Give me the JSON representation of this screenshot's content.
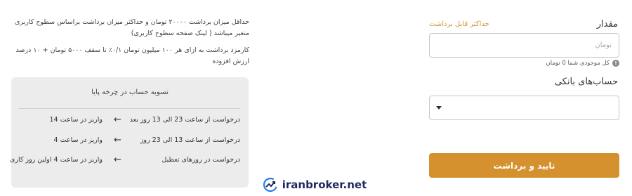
{
  "form": {
    "amount_label": "مقدار",
    "max_link": "حداکثر قابل برداشت",
    "amount_placeholder": "تومان",
    "balance_text": "کل موجودی شما 0 تومان",
    "info_icon": "info-icon",
    "bank_label": "حساب‌های بانکی",
    "bank_select_value": "",
    "submit_label": "تایید و برداشت"
  },
  "info": {
    "line1": "حداقل میزان برداشت ۲۰۰۰۰ تومان و حداکثر میزان برداشت براساس سطوح کاربری متغیر میباشد ( لینک صفحه سطوح کاربری)",
    "line2": "کارمزد برداشت به ازای هر ۱۰۰ میلیون تومان ۰/۱٪ تا سقف ۵۰۰۰ تومان + ۱۰ درصد ارزش افزوده"
  },
  "schedule": {
    "title": "تسویه حساب در چرخه پایا",
    "rows": [
      {
        "request": "درخواست از ساعت 23 الی 13 روز بعد",
        "deposit": "واریز در ساعت 14"
      },
      {
        "request": "درخواست از ساعت 13 الی 23 روز",
        "deposit": "واریز در ساعت 4"
      },
      {
        "request": "درخواست در روزهای تعطیل",
        "deposit": "واریز در ساعت 4 اولین روز کاری"
      }
    ]
  },
  "watermark": {
    "text": "iranbroker.net"
  },
  "colors": {
    "accent": "#d4912e",
    "card_bg": "#ececec",
    "watermark_text": "#1f2b5c",
    "watermark_logo": "#2b7de9"
  }
}
